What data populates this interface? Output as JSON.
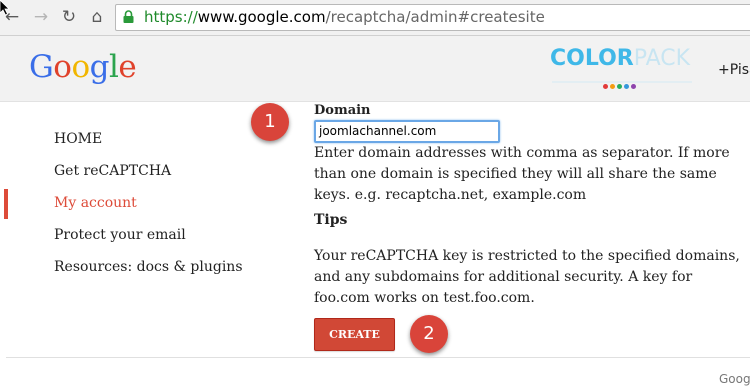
{
  "browser": {
    "url_scheme": "https://",
    "url_host": "www.google.com",
    "url_path": "/recaptcha/admin#createsite",
    "back_icon": "←",
    "forward_icon": "→",
    "reload_icon": "↻",
    "home_icon": "⌂"
  },
  "header": {
    "logo": [
      "G",
      "o",
      "o",
      "g",
      "l",
      "e"
    ],
    "logo_colors": [
      "#3a6ee8",
      "#e0422b",
      "#f1b600",
      "#3a6ee8",
      "#2ca44e",
      "#e0422b"
    ],
    "colorpack_bold": "COLOR",
    "colorpack_light": "PACK",
    "colorpack_dot_colors": [
      "#e23b3b",
      "#f39c12",
      "#27ae60",
      "#3498db",
      "#8e44ad"
    ],
    "user_link": "+Pisa"
  },
  "nav": {
    "items": [
      {
        "label": "HOME"
      },
      {
        "label": "Get reCAPTCHA"
      },
      {
        "label": "My account"
      },
      {
        "label": "Protect your email"
      },
      {
        "label": "Resources: docs & plugins"
      }
    ]
  },
  "form": {
    "domain_label": "Domain",
    "domain_value": "joomlachannel.com",
    "domain_help": "Enter domain addresses with comma as separator. If more than one domain is specified they will all share the same keys. e.g. recaptcha.net, example.com",
    "tips_heading": "Tips",
    "tips_text": "Your reCAPTCHA key is restricted to the specified domains, and any subdomains for additional security. A key for foo.com works on test.foo.com.",
    "create_label": "CREATE"
  },
  "markers": {
    "step1": "1",
    "step2": "2"
  },
  "footer": {
    "text": "Goog"
  },
  "colors": {
    "accent_red": "#dd4b39",
    "button_red": "#d14836",
    "url_green": "#1f8a2b"
  }
}
